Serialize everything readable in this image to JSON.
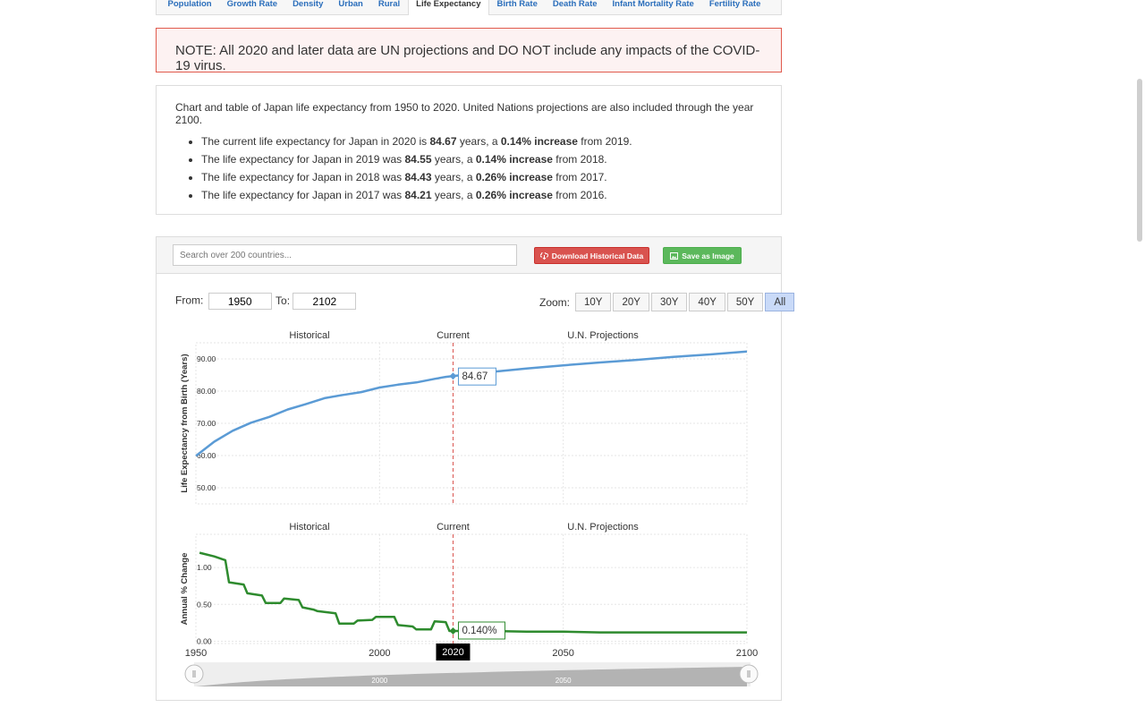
{
  "tabs": [
    {
      "label": "Population",
      "active": false
    },
    {
      "label": "Growth Rate",
      "active": false
    },
    {
      "label": "Density",
      "active": false
    },
    {
      "label": "Urban",
      "active": false
    },
    {
      "label": "Rural",
      "active": false
    },
    {
      "label": "Life Expectancy",
      "active": true
    },
    {
      "label": "Birth Rate",
      "active": false
    },
    {
      "label": "Death Rate",
      "active": false
    },
    {
      "label": "Infant Mortality Rate",
      "active": false
    },
    {
      "label": "Fertility Rate",
      "active": false
    }
  ],
  "note": "NOTE: All 2020 and later data are UN projections and DO NOT include any impacts of the COVID-19 virus.",
  "summary": {
    "intro": "Chart and table of Japan life expectancy from 1950 to 2020. United Nations projections are also included through the year 2100.",
    "items": [
      {
        "pre": "The current life expectancy for Japan in 2020 is ",
        "value": "84.67",
        "mid": " years, a ",
        "pct": "0.14% increase",
        "post": " from 2019."
      },
      {
        "pre": "The life expectancy for Japan in 2019 was ",
        "value": "84.55",
        "mid": " years, a ",
        "pct": "0.14% increase",
        "post": " from 2018."
      },
      {
        "pre": "The life expectancy for Japan in 2018 was ",
        "value": "84.43",
        "mid": " years, a ",
        "pct": "0.26% increase",
        "post": " from 2017."
      },
      {
        "pre": "The life expectancy for Japan in 2017 was ",
        "value": "84.21",
        "mid": " years, a ",
        "pct": "0.26% increase",
        "post": " from 2016."
      }
    ]
  },
  "toolbar": {
    "search_placeholder": "Search over 200 countries...",
    "download_label": "Download Historical Data",
    "save_label": "Save as Image"
  },
  "range": {
    "from_label": "From:",
    "from_value": "1950",
    "to_label": "To:",
    "to_value": "2102"
  },
  "zoom": {
    "label": "Zoom:",
    "options": [
      "10Y",
      "20Y",
      "30Y",
      "40Y",
      "50Y",
      "All"
    ],
    "selected": "All"
  },
  "colors": {
    "life_line": "#5b9bd5",
    "change_line": "#2e8b2e",
    "current_marker": "#d9534f",
    "accent": "#2a6ebb"
  },
  "chart_data": [
    {
      "type": "line",
      "ylabel": "Life Expectancy from Birth (Years)",
      "xlim": [
        1950,
        2100
      ],
      "ylim": [
        45,
        95
      ],
      "yticks": [
        50,
        60,
        70,
        80,
        90
      ],
      "ytick_labels": [
        "50.00",
        "60.00",
        "70.00",
        "80.00",
        "90.00"
      ],
      "region_labels": [
        "Historical",
        "Current",
        "U.N. Projections"
      ],
      "current_year": 2020,
      "tooltip": "84.67",
      "series": [
        {
          "x": [
            1950,
            1955,
            1960,
            1965,
            1970,
            1975,
            1980,
            1985,
            1990,
            1995,
            2000,
            2005,
            2010,
            2015,
            2016,
            2017,
            2018,
            2019,
            2020,
            2030,
            2040,
            2050,
            2060,
            2070,
            2080,
            2090,
            2100
          ],
          "values": [
            59.9,
            64.3,
            67.7,
            70.2,
            72.0,
            74.3,
            76.0,
            77.8,
            78.8,
            79.7,
            81.1,
            82.0,
            82.7,
            83.8,
            83.99,
            84.21,
            84.43,
            84.55,
            84.67,
            85.9,
            87.0,
            88.0,
            88.9,
            89.7,
            90.6,
            91.4,
            92.3
          ]
        }
      ]
    },
    {
      "type": "line",
      "ylabel": "Annual % Change",
      "xlim": [
        1950,
        2100
      ],
      "ylim": [
        -0.03,
        1.45
      ],
      "yticks": [
        0.0,
        0.5,
        1.0
      ],
      "ytick_labels": [
        "0.00",
        "0.50",
        "1.00"
      ],
      "xticks": [
        1950,
        2000,
        2050,
        2100
      ],
      "xtick_labels": [
        "1950",
        "2000",
        "2050",
        "2100"
      ],
      "region_labels": [
        "Historical",
        "Current",
        "U.N. Projections"
      ],
      "current_year": 2020,
      "current_label": "2020",
      "tooltip": "0.140%",
      "series": [
        {
          "x": [
            1951,
            1955,
            1958,
            1959,
            1963,
            1964,
            1968,
            1969,
            1973,
            1974,
            1978,
            1979,
            1982,
            1983,
            1988,
            1989,
            1993,
            1994,
            1998,
            1999,
            2004,
            2005,
            2009,
            2010,
            2014,
            2015,
            2018,
            2019,
            2020,
            2030,
            2040,
            2050,
            2060,
            2070,
            2080,
            2090,
            2100
          ],
          "values": [
            1.2,
            1.15,
            1.1,
            0.8,
            0.77,
            0.65,
            0.62,
            0.52,
            0.52,
            0.58,
            0.56,
            0.46,
            0.43,
            0.41,
            0.38,
            0.24,
            0.24,
            0.28,
            0.29,
            0.33,
            0.33,
            0.22,
            0.2,
            0.16,
            0.16,
            0.27,
            0.26,
            0.14,
            0.14,
            0.14,
            0.13,
            0.13,
            0.12,
            0.12,
            0.12,
            0.12,
            0.12
          ]
        }
      ]
    }
  ],
  "navigator": {
    "xtick_labels": [
      "2000",
      "2050"
    ]
  }
}
